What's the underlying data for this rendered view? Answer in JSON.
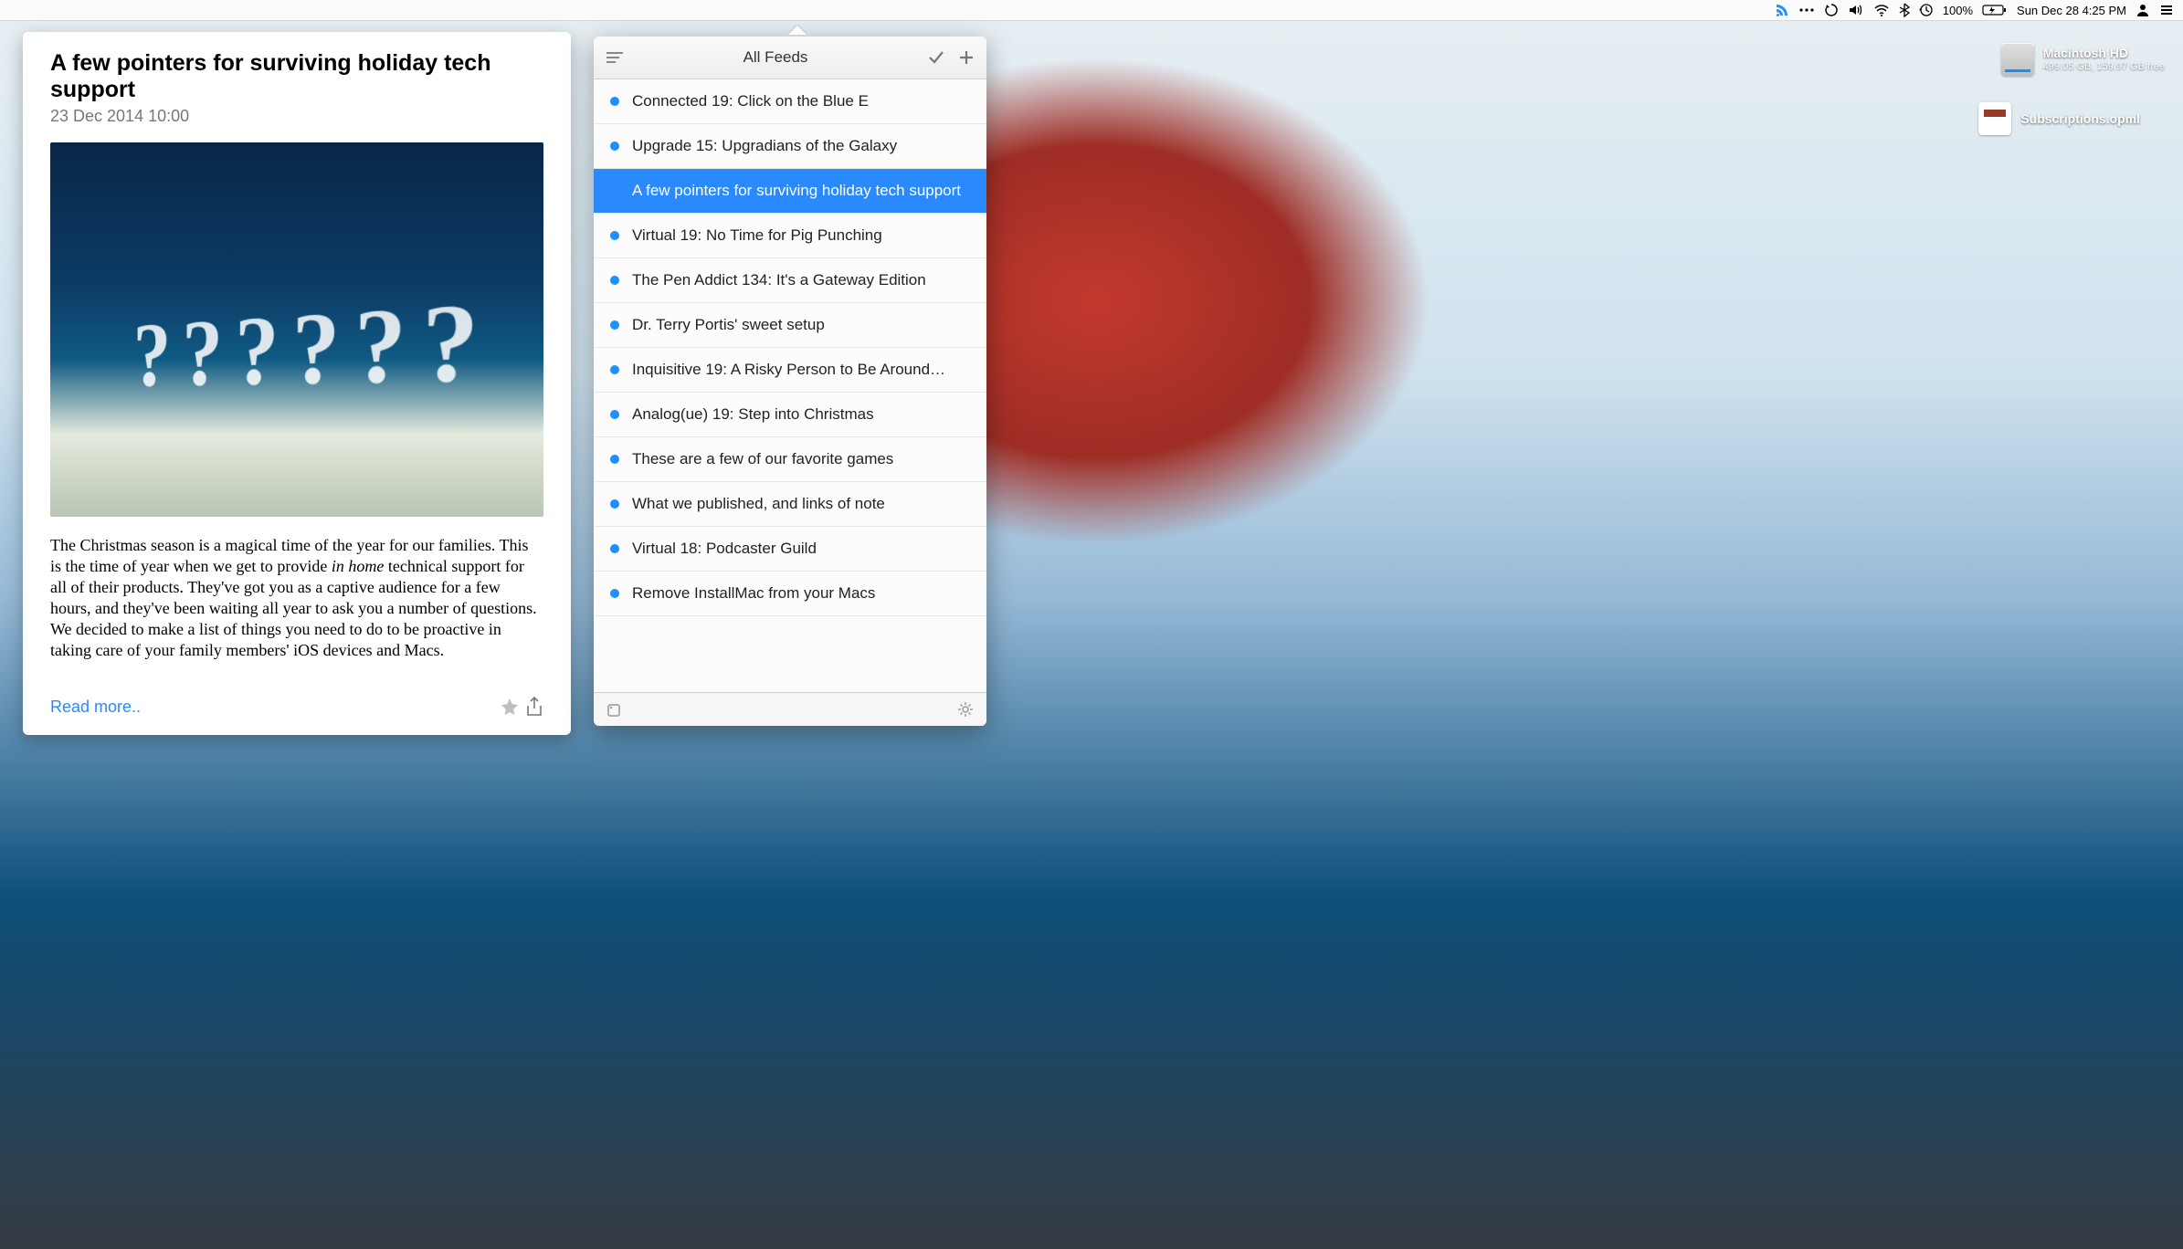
{
  "menubar": {
    "battery_percent": "100%",
    "date_time": "Sun Dec 28  4:25 PM"
  },
  "desktop": {
    "hd": {
      "name": "Macintosh HD",
      "detail": "499.05 GB, 159.97 GB free"
    },
    "opml": {
      "name": "Subscriptions.opml"
    }
  },
  "article": {
    "title": "A few pointers for surviving holiday tech support",
    "date": "23 Dec 2014 10:00",
    "body_pre": "The Christmas season is a magical time of the year for our families. This is the time of year when we get to provide ",
    "body_em": "in home",
    "body_post": " technical support for all of their products. They've got you as a captive audience for a few hours, and they've been waiting all year to ask you a number of questions. We decided to make a list of things you need to do to be proactive in taking care of your family members' iOS devices and Macs.",
    "readmore": "Read more.."
  },
  "feed": {
    "title": "All Feeds",
    "items": [
      {
        "label": "Connected 19: Click on the Blue E",
        "selected": false
      },
      {
        "label": "Upgrade 15: Upgradians of the Galaxy",
        "selected": false
      },
      {
        "label": "A few pointers for surviving holiday tech support",
        "selected": true
      },
      {
        "label": "Virtual 19: No Time for Pig Punching",
        "selected": false
      },
      {
        "label": "The Pen Addict 134: It's a Gateway Edition",
        "selected": false
      },
      {
        "label": "Dr. Terry Portis' sweet setup",
        "selected": false
      },
      {
        "label": "Inquisitive 19: A Risky Person to Be Around…",
        "selected": false
      },
      {
        "label": "Analog(ue) 19: Step into Christmas",
        "selected": false
      },
      {
        "label": "These are a few of our favorite games",
        "selected": false
      },
      {
        "label": "What we published, and links of note",
        "selected": false
      },
      {
        "label": "Virtual 18: Podcaster Guild",
        "selected": false
      },
      {
        "label": "Remove InstallMac from your Macs",
        "selected": false
      }
    ]
  }
}
